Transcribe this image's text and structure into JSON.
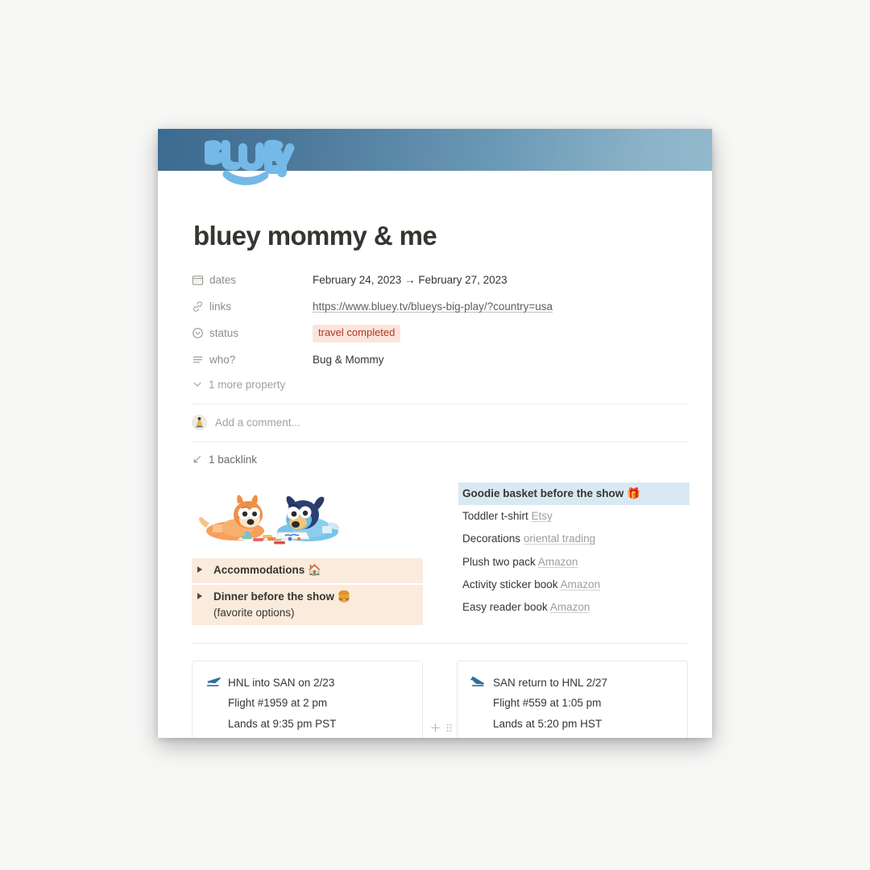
{
  "banner": {
    "logo_text": "BLUEY",
    "logo_color": "#6fb5e8",
    "gradient_from": "#3c6b91",
    "gradient_to": "#92b8cc"
  },
  "page": {
    "title": "bluey mommy & me"
  },
  "properties": {
    "rows": [
      {
        "icon": "calendar-icon",
        "label": "dates",
        "value": "February 24, 2023 → February 27, 2023",
        "type": "text"
      },
      {
        "icon": "link-icon",
        "label": "links",
        "value": "https://www.bluey.tv/blueys-big-play/?country=usa",
        "type": "link"
      },
      {
        "icon": "select-icon",
        "label": "status",
        "value": "travel completed",
        "type": "badge",
        "badge_bg": "#fbe4dd",
        "badge_fg": "#b03b1e"
      },
      {
        "icon": "text-lines-icon",
        "label": "who?",
        "value": "Bug & Mommy",
        "type": "text"
      }
    ],
    "more_label": "1 more property",
    "more_icon": "chevron-down-icon"
  },
  "comment": {
    "placeholder": "Add a comment...",
    "avatar": "user-avatar"
  },
  "backlink": {
    "label": "1 backlink",
    "icon": "backlink-arrow-icon"
  },
  "left_column": {
    "image": "bluey-and-bingo-drawing-illustration",
    "toggles": [
      {
        "icon": "toggle-triangle-icon",
        "title": "Accommodations",
        "emoji": "🏠",
        "subtitle": ""
      },
      {
        "icon": "toggle-triangle-icon",
        "title": "Dinner before the show",
        "emoji": "🍔",
        "subtitle": "(favorite options)"
      }
    ]
  },
  "right_column": {
    "items": [
      {
        "text": "Goodie basket before the show",
        "emoji": "🎁",
        "source": "",
        "selected": true,
        "bold": true
      },
      {
        "text": "Toddler t-shirt",
        "emoji": "",
        "source": "Etsy",
        "selected": false,
        "bold": false
      },
      {
        "text": "Decorations",
        "emoji": "",
        "source": "oriental trading",
        "selected": false,
        "bold": false
      },
      {
        "text": "Plush two pack",
        "emoji": "",
        "source": "Amazon",
        "selected": false,
        "bold": false
      },
      {
        "text": "Activity sticker book",
        "emoji": "",
        "source": "Amazon",
        "selected": false,
        "bold": false
      },
      {
        "text": "Easy reader book",
        "emoji": "",
        "source": "Amazon",
        "selected": false,
        "bold": false
      }
    ],
    "selection_color": "#d9e9f3"
  },
  "flight_cards": [
    {
      "icon": "airplane-departure-icon",
      "line1": "HNL into SAN on 2/23",
      "line2": "Flight #1959 at 2 pm",
      "line3": "Lands at 9:35 pm PST"
    },
    {
      "icon": "airplane-arrival-icon",
      "line1": "SAN return to HNL 2/27",
      "line2": "Flight #559 at 1:05 pm",
      "line3": "Lands at 5:20 pm HST"
    }
  ],
  "hover_tools": {
    "add_icon": "plus-icon",
    "drag_icon": "drag-handle-icon"
  }
}
